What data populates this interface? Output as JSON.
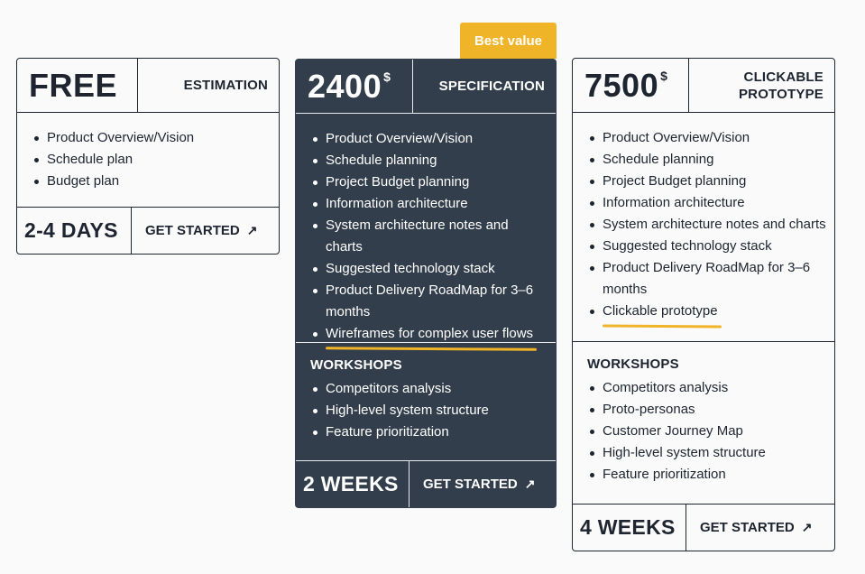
{
  "badge": {
    "label": "Best value",
    "color": "#f0b429"
  },
  "colors": {
    "dark_card": "#323e4b",
    "text": "#1e2530",
    "highlight": "#f0b429",
    "background": "#fafafa"
  },
  "plans": [
    {
      "price": "FREE",
      "currency": "",
      "name": "ESTIMATION",
      "features": [
        "Product Overview/Vision",
        "Schedule plan",
        "Budget plan"
      ],
      "duration": "2-4 DAYS",
      "cta": "GET STARTED",
      "cta_icon": "arrow-up-right-icon"
    },
    {
      "price": "2400",
      "currency": "$",
      "name": "SPECIFICATION",
      "features": [
        "Product Overview/Vision",
        "Schedule planning",
        "Project Budget planning",
        "Information architecture",
        "System architecture notes and charts",
        "Suggested technology stack",
        "Product Delivery RoadMap for 3–6 months",
        "Wireframes for complex user flows"
      ],
      "highlighted_feature": "Wireframes for complex user flows",
      "workshops_title": "WORKSHOPS",
      "workshops": [
        "Competitors analysis",
        "High-level system structure",
        "Feature prioritization"
      ],
      "duration": "2 WEEKS",
      "cta": "GET STARTED",
      "cta_icon": "arrow-up-right-icon"
    },
    {
      "price": "7500",
      "currency": "$",
      "name_line1": "CLICKABLE",
      "name_line2": "PROTOTYPE",
      "features": [
        "Product Overview/Vision",
        "Schedule planning",
        "Project Budget planning",
        "Information architecture",
        "System architecture notes and charts",
        "Suggested technology stack",
        "Product Delivery RoadMap for 3–6 months",
        "Clickable prototype"
      ],
      "highlighted_feature": "Clickable prototype",
      "workshops_title": "WORKSHOPS",
      "workshops": [
        "Competitors analysis",
        "Proto-personas",
        "Customer Journey Map",
        "High-level system structure",
        "Feature prioritization"
      ],
      "duration": "4 WEEKS",
      "cta": "GET STARTED",
      "cta_icon": "arrow-up-right-icon"
    }
  ]
}
